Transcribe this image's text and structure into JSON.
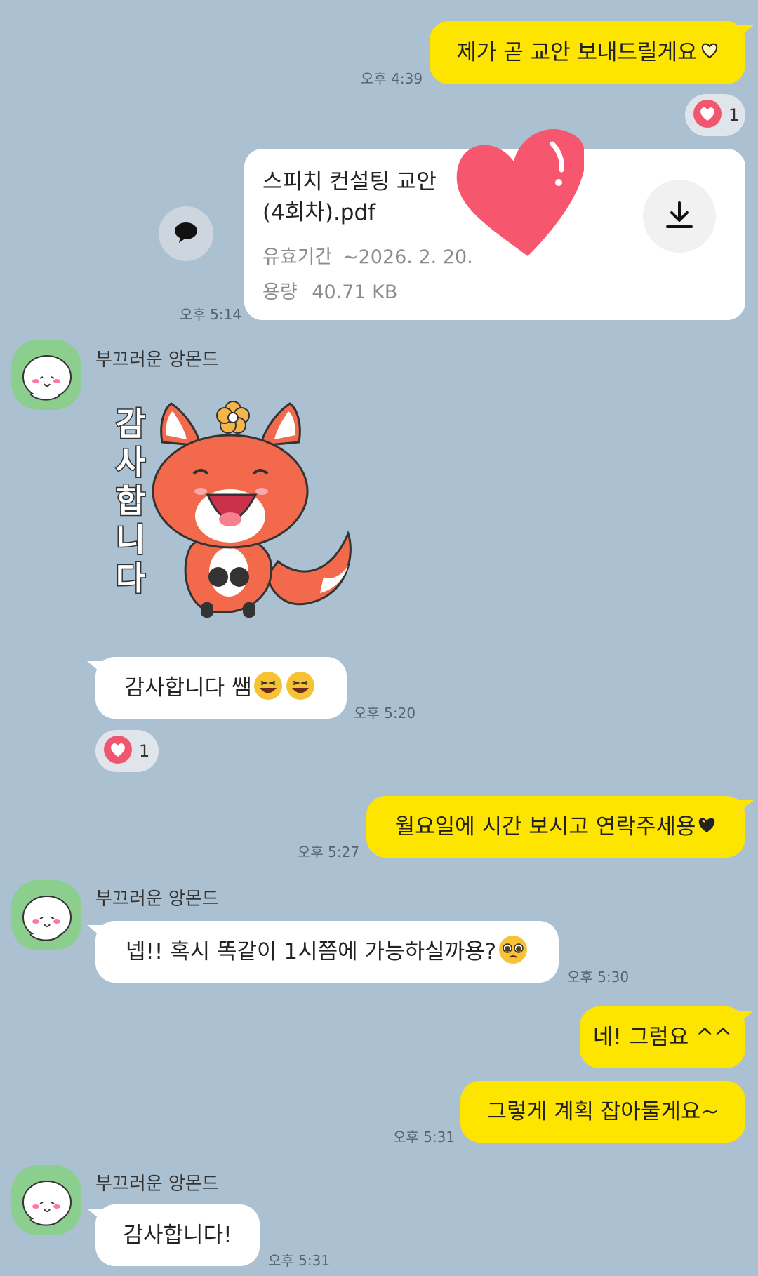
{
  "colors": {
    "background": "#abc1d1",
    "my_bubble": "#fee500",
    "their_bubble": "#ffffff",
    "avatar_bg": "#8bce8e",
    "heart": "#f0576f"
  },
  "messages": {
    "m1": {
      "text": "제가 곧 교안 보내드릴게요",
      "emoji": "yellow-heart-outline-icon",
      "time": "오후 4:39",
      "reaction_count": "1"
    },
    "file": {
      "name_line1": "스피치 컨설팅 교안",
      "name_line2": "(4회차).pdf",
      "expiry_label": "유효기간",
      "expiry_value": "~2026. 2. 20.",
      "size_label": "용량",
      "size_value": "40.71 KB",
      "time": "오후 5:14",
      "overlay_sticker": "big-pink-heart-icon"
    },
    "m2_sticker": {
      "sender": "부끄러운 앙몬드",
      "sticker_text": "감사합니다",
      "sticker": "fox-thank-you-sticker"
    },
    "m3": {
      "text": "감사합니다 쌤",
      "emoji": "laughing-face-icon",
      "time": "오후 5:20",
      "reaction_count": "1"
    },
    "m4": {
      "text": "월요일에 시간 보시고 연락주세용",
      "emoji": "black-heart-icon",
      "time": "오후 5:27"
    },
    "m5": {
      "sender": "부끄러운 앙몬드",
      "text": "넵!! 혹시 똑같이 1시쯤에 가능하실까용?",
      "emoji": "pleading-face-icon",
      "time": "오후 5:30"
    },
    "m6": {
      "text": "네! 그럼요 ^^"
    },
    "m7": {
      "text": "그렇게 계획 잡아둘게요~",
      "time": "오후 5:31"
    },
    "m8": {
      "sender": "부끄러운 앙몬드",
      "text": "감사합니다!",
      "time": "오후 5:31"
    }
  }
}
